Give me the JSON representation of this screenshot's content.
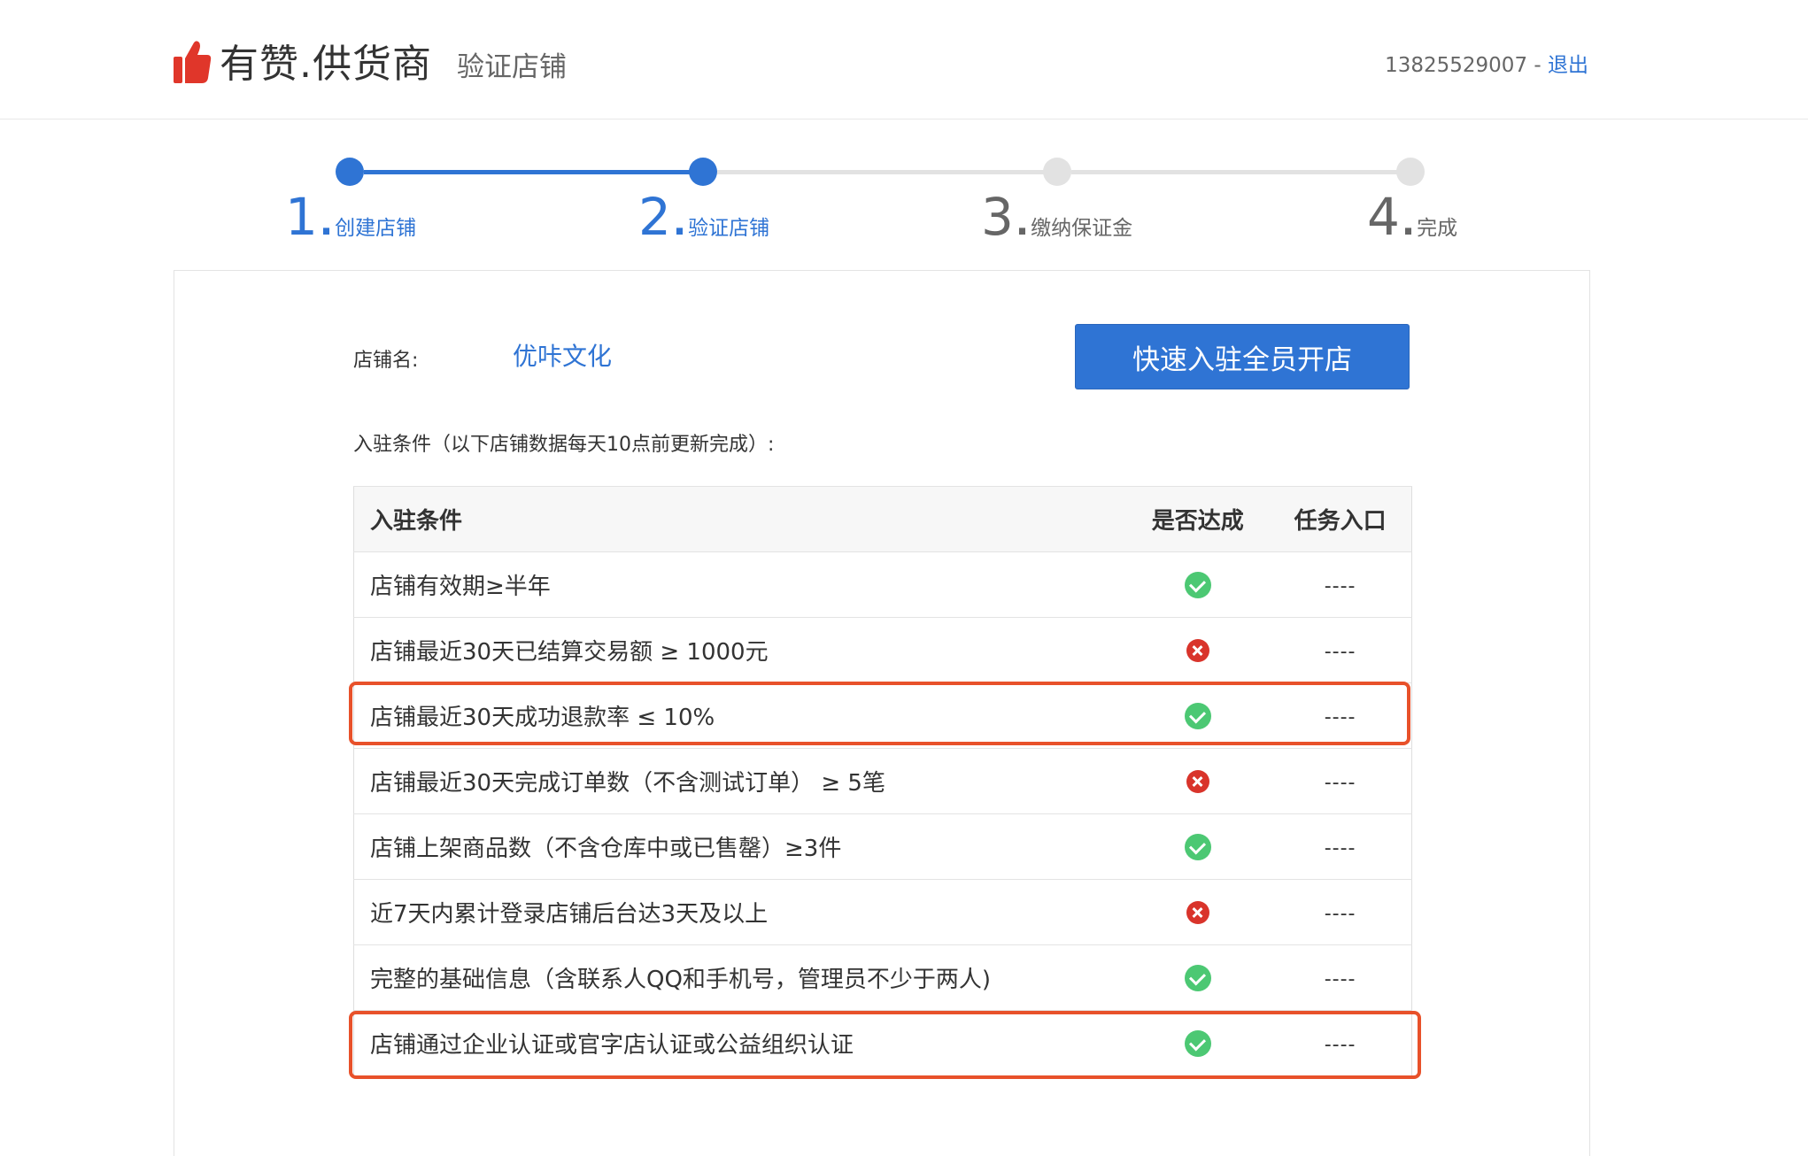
{
  "header": {
    "logo_text": "有赞.供货商",
    "subtitle": "验证店铺",
    "phone": "13825529007",
    "separator": " - ",
    "logout": "退出"
  },
  "steps": [
    {
      "num": "1",
      "label": "创建店铺",
      "done": true
    },
    {
      "num": "2",
      "label": "验证店铺",
      "done": true
    },
    {
      "num": "3",
      "label": "缴纳保证金",
      "done": false
    },
    {
      "num": "4",
      "label": "完成",
      "done": false
    }
  ],
  "shop": {
    "name_label": "店铺名:",
    "name": "优咔文化",
    "fast_button": "快速入驻全员开店"
  },
  "conditions_title": "入驻条件（以下店铺数据每天10点前更新完成）:",
  "table": {
    "headers": [
      "入驻条件",
      "是否达成",
      "任务入口"
    ],
    "rows": [
      {
        "condition": "店铺有效期≥半年",
        "achieved": true,
        "entry": "----"
      },
      {
        "condition": "店铺最近30天已结算交易额 ≥ 1000元",
        "achieved": false,
        "entry": "----"
      },
      {
        "condition": "店铺最近30天成功退款率 ≤ 10%",
        "achieved": true,
        "entry": "----",
        "highlight": true
      },
      {
        "condition": "店铺最近30天完成订单数（不含测试订单） ≥ 5笔",
        "achieved": false,
        "entry": "----"
      },
      {
        "condition": "店铺上架商品数（不含仓库中或已售罄）≥3件",
        "achieved": true,
        "entry": "----"
      },
      {
        "condition": "近7天内累计登录店铺后台达3天及以上",
        "achieved": false,
        "entry": "----"
      },
      {
        "condition": "完整的基础信息（含联系人QQ和手机号，管理员不少于两人)",
        "achieved": true,
        "entry": "----"
      },
      {
        "condition": "店铺通过企业认证或官字店认证或公益组织认证",
        "achieved": true,
        "entry": "----",
        "highlight": true
      }
    ]
  },
  "colors": {
    "accent": "#2f74d4",
    "success": "#4cc873",
    "fail": "#d9342b",
    "highlight": "#e8512a"
  }
}
